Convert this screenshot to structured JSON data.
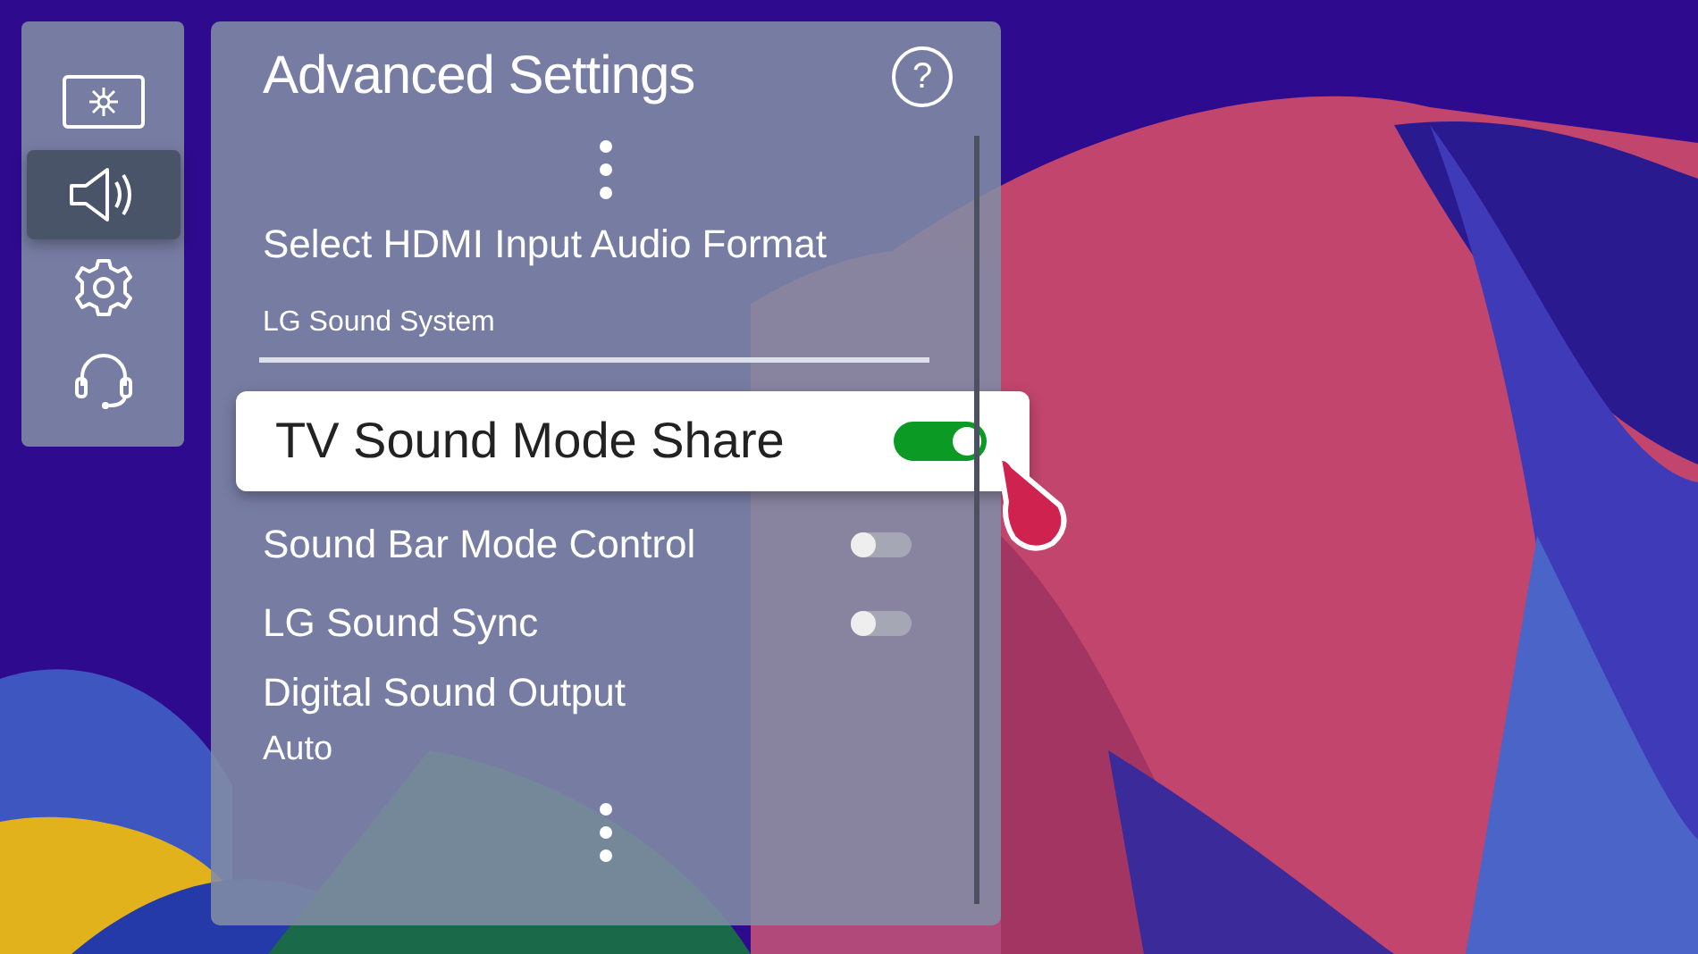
{
  "sidebar": {
    "items": [
      {
        "selected": false
      },
      {
        "selected": true
      },
      {
        "selected": false
      },
      {
        "selected": false
      }
    ]
  },
  "panel": {
    "title": "Advanced Settings",
    "help_icon": "?",
    "items": [
      {
        "kind": "option",
        "label": "Select HDMI Input Audio Format",
        "value": "LG Sound System"
      },
      {
        "kind": "toggle",
        "label": "TV Sound Mode Share",
        "on": true,
        "focused": true
      },
      {
        "kind": "toggle",
        "label": "Sound Bar Mode Control",
        "on": false,
        "focused": false
      },
      {
        "kind": "toggle",
        "label": "LG Sound Sync",
        "on": false,
        "focused": false
      },
      {
        "kind": "value",
        "label": "Digital Sound Output",
        "value": "Auto"
      }
    ]
  }
}
